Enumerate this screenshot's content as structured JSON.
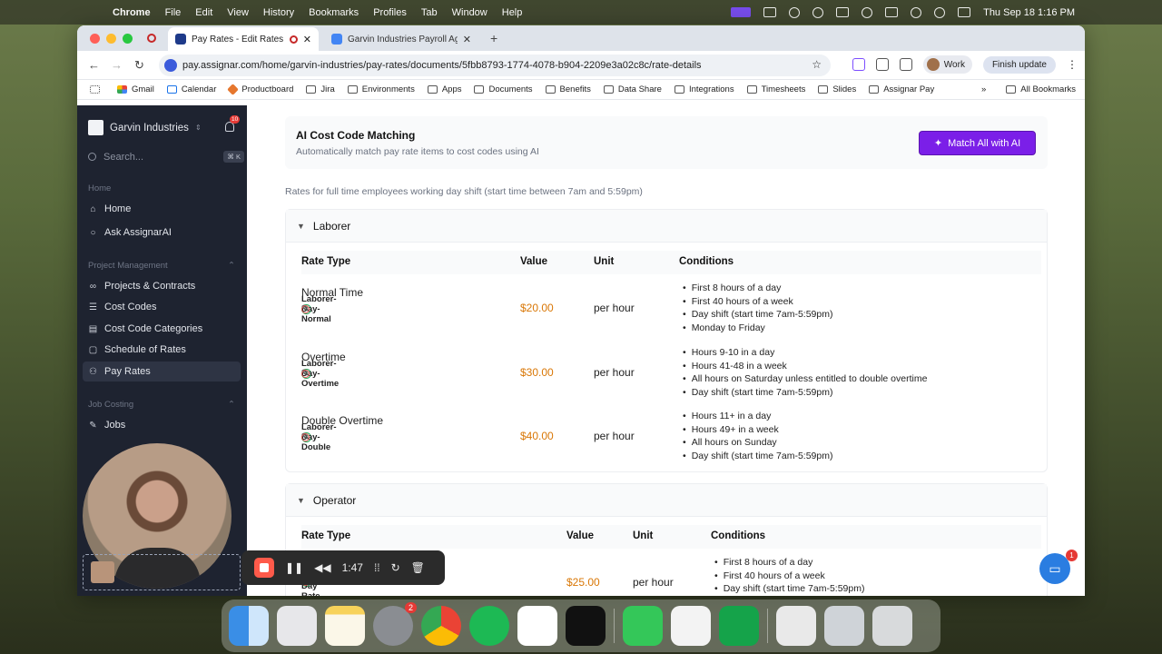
{
  "menubar": {
    "app": "Chrome",
    "items": [
      "File",
      "Edit",
      "View",
      "History",
      "Bookmarks",
      "Profiles",
      "Tab",
      "Window",
      "Help"
    ],
    "clock": "Thu Sep 18  1:16 PM"
  },
  "browser": {
    "tabs": [
      {
        "title": "Pay Rates - Edit Rates Da"
      },
      {
        "title": "Garvin Industries Payroll Agre"
      }
    ],
    "url": "pay.assignar.com/home/garvin-industries/pay-rates/documents/5fbb8793-1774-4078-b904-2209e3a02c8c/rate-details",
    "profile": "Work",
    "update_label": "Finish update",
    "bookmarks": [
      "Gmail",
      "Calendar",
      "Productboard",
      "Jira",
      "Environments",
      "Apps",
      "Documents",
      "Benefits",
      "Data Share",
      "Integrations",
      "Timesheets",
      "Slides",
      "Assignar Pay"
    ],
    "all_bookmarks": "All Bookmarks"
  },
  "sidebar": {
    "org": "Garvin Industries",
    "bell_count": "10",
    "search_placeholder": "Search...",
    "search_shortcut": "⌘ K",
    "sections": [
      {
        "label": "Home",
        "items": [
          {
            "label": "Home",
            "icon": "home-icon"
          },
          {
            "label": "Ask AssignarAI",
            "icon": "chat-icon"
          }
        ]
      },
      {
        "label": "Project Management",
        "items": [
          {
            "label": "Projects & Contracts",
            "icon": "binoculars-icon"
          },
          {
            "label": "Cost Codes",
            "icon": "list-icon"
          },
          {
            "label": "Cost Code Categories",
            "icon": "categories-icon"
          },
          {
            "label": "Schedule of Rates",
            "icon": "document-icon"
          },
          {
            "label": "Pay Rates",
            "icon": "people-icon",
            "active": true
          }
        ]
      },
      {
        "label": "Job Costing",
        "items": [
          {
            "label": "Jobs",
            "icon": "wrench-icon"
          }
        ]
      }
    ]
  },
  "main": {
    "ai_card": {
      "title": "AI Cost Code Matching",
      "description": "Automatically match pay rate items to cost codes using AI",
      "button": "Match All with AI"
    },
    "note": "Rates for full time employees working day shift (start time between 7am and 5:59pm)",
    "columns": {
      "rate_type": "Rate Type",
      "value": "Value",
      "unit": "Unit",
      "conditions": "Conditions"
    },
    "groups": [
      {
        "name": "Laborer",
        "rows": [
          {
            "name": "Normal Time",
            "code": "Laborer-Day-Normal",
            "value": "$20.00",
            "unit": "per hour",
            "conditions": [
              "First 8 hours of a day",
              "First 40 hours of a week",
              "Day shift (start time 7am-5:59pm)",
              "Monday to Friday"
            ]
          },
          {
            "name": "Overtime",
            "code": "Laborer-Day-Overtime",
            "value": "$30.00",
            "unit": "per hour",
            "conditions": [
              "Hours 9-10 in a day",
              "Hours 41-48 in a week",
              "All hours on Saturday unless entitled to double overtime",
              "Day shift (start time 7am-5:59pm)"
            ]
          },
          {
            "name": "Double Overtime",
            "code": "Laborer-Day-Double",
            "value": "$40.00",
            "unit": "per hour",
            "conditions": [
              "Hours 11+ in a day",
              "Hours 49+ in a week",
              "All hours on Sunday",
              "Day shift (start time 7am-5:59pm)"
            ]
          }
        ]
      },
      {
        "name": "Operator",
        "rows": [
          {
            "name": "",
            "code": "Operator Normal Day Rate",
            "value": "$25.00",
            "unit": "per hour",
            "conditions": [
              "First 8 hours of a day",
              "First 40 hours of a week",
              "Day shift (start time 7am-5:59pm)"
            ]
          }
        ]
      }
    ]
  },
  "recording": {
    "time": "1:47"
  },
  "dock": {
    "settings_badge": "2"
  },
  "help_badge": "1"
}
